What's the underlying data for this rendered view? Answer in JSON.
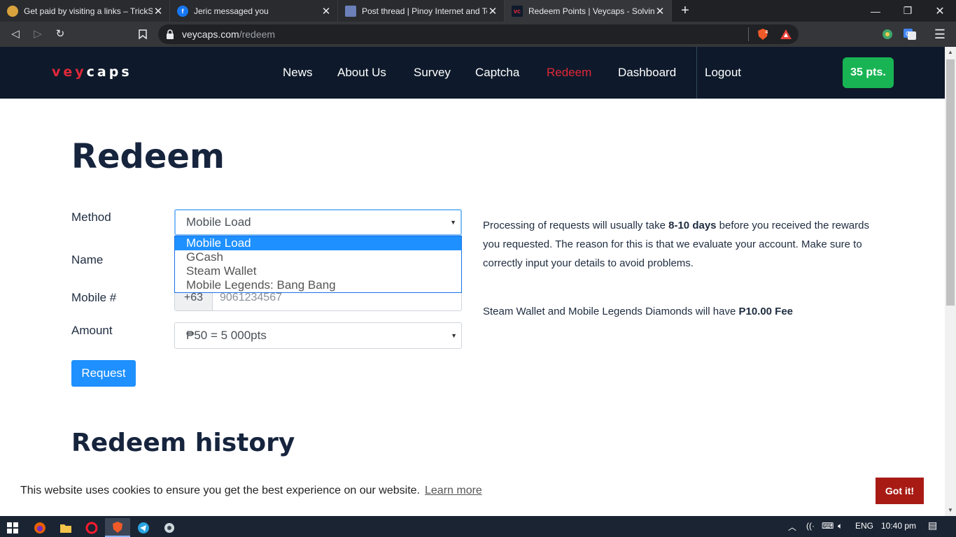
{
  "browser": {
    "tabs": [
      {
        "title": "Get paid by visiting a links – TrickS",
        "icon": "trickshot-favicon"
      },
      {
        "title": "Jeric messaged you",
        "icon": "facebook-favicon"
      },
      {
        "title": "Post thread | Pinoy Internet and Te",
        "icon": "pinoy-forum-favicon"
      },
      {
        "title": "Redeem Points | Veycaps - Solving",
        "icon": "veycaps-favicon",
        "favicon_text": "vc"
      }
    ],
    "url_host": "veycaps.com",
    "url_path": "/redeem",
    "shield_count": "4"
  },
  "site": {
    "logo_prefix": "vey",
    "logo_suffix": "caps",
    "nav": {
      "news": "News",
      "about": "About Us",
      "survey": "Survey",
      "captcha": "Captcha",
      "redeem": "Redeem",
      "dashboard": "Dashboard",
      "logout": "Logout"
    },
    "points": "35 pts.",
    "colors": {
      "header_bg": "#0e1a2b",
      "accent_red": "#e0283a",
      "points_green": "#18b454",
      "primary_blue": "#1e90ff"
    }
  },
  "page": {
    "title": "Redeem",
    "form": {
      "method_label": "Method",
      "method_value": "Mobile Load",
      "method_options": [
        "Mobile Load",
        "GCash",
        "Steam Wallet",
        "Mobile Legends: Bang Bang"
      ],
      "name_label": "Name",
      "mobile_label": "Mobile #",
      "mobile_prefix": "+63",
      "mobile_placeholder": "9061234567",
      "amount_label": "Amount",
      "amount_value": "₱50 = 5 000pts",
      "request_button": "Request"
    },
    "info": {
      "p1_before": "Processing of requests will usually take ",
      "p1_bold": "8-10 days",
      "p1_after": " before you received the rewards you requested. The reason for this is that we evaluate your account. Make sure to correctly input your details to avoid problems.",
      "fee_before": "Steam Wallet and Mobile Legends Diamonds will have ",
      "fee_bold": "P10.00 Fee"
    },
    "history_title": "Redeem history"
  },
  "cookie": {
    "message": "This website uses cookies to ensure you get the best experience on our website.",
    "learn_more": "Learn more",
    "accept": "Got it!"
  },
  "taskbar": {
    "language": "ENG",
    "time": "10:40 pm"
  }
}
